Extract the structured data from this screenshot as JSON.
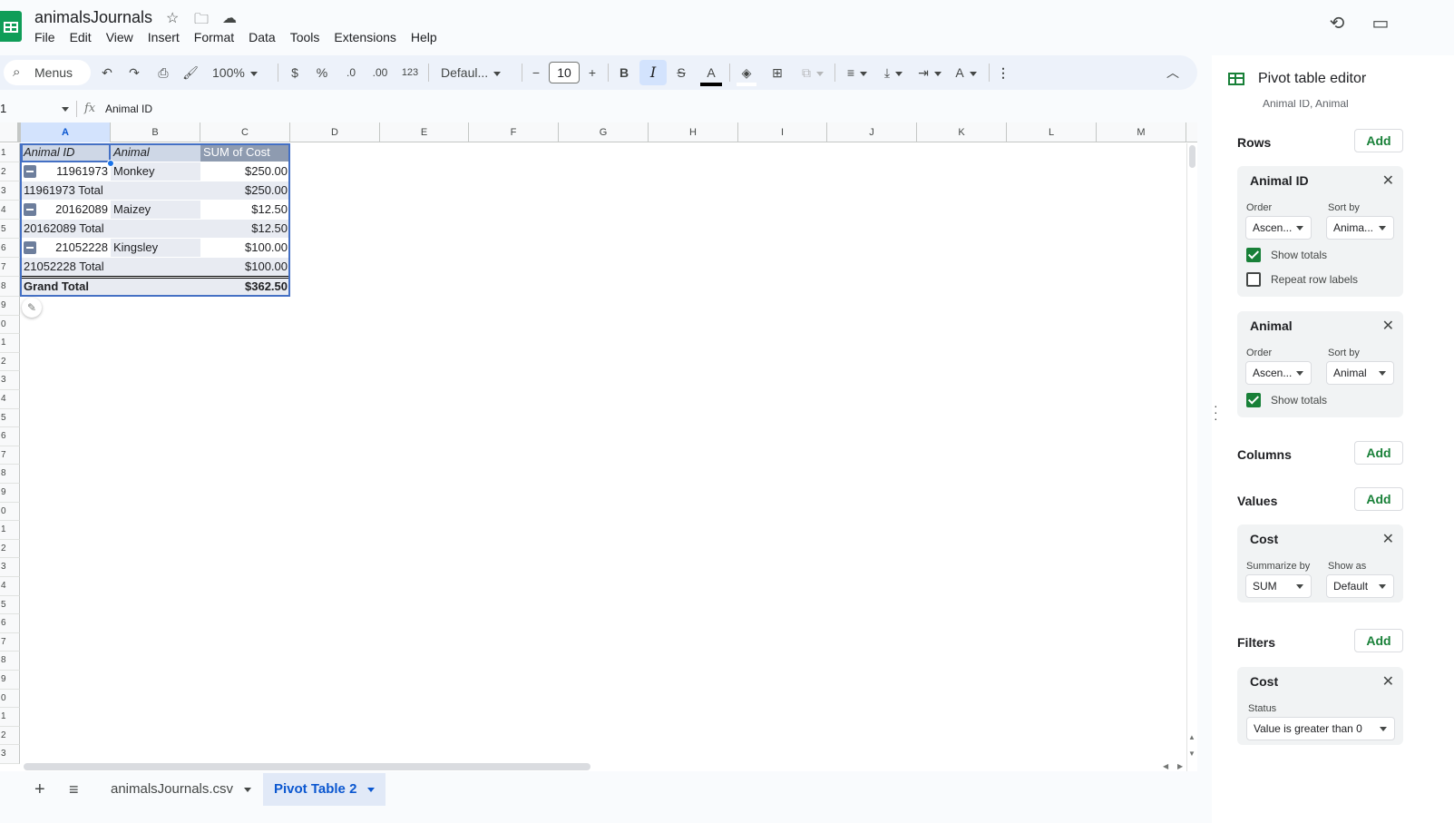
{
  "app": {
    "doc_title": "animalsJournals",
    "menu": [
      "File",
      "Edit",
      "View",
      "Insert",
      "Format",
      "Data",
      "Tools",
      "Extensions",
      "Help"
    ]
  },
  "toolbar": {
    "menus_label": "Menus",
    "zoom": "100%",
    "currency": "$",
    "percent": "%",
    "dec_decrease": ".0",
    "dec_increase": ".00",
    "format_123": "123",
    "font": "Defaul...",
    "font_size": "10",
    "bold": "B",
    "italic": "I"
  },
  "formula_bar": {
    "name_box": "1",
    "fx": "fx",
    "content": "Animal ID"
  },
  "columns": [
    "A",
    "B",
    "C",
    "D",
    "E",
    "F",
    "G",
    "H",
    "I",
    "J",
    "K",
    "L",
    "M"
  ],
  "rows": [
    "1",
    "2",
    "3",
    "4",
    "5",
    "6",
    "7",
    "8",
    "9",
    "0",
    "1",
    "2",
    "3",
    "4",
    "5",
    "6",
    "7",
    "8",
    "9",
    "0",
    "1",
    "2",
    "3",
    "4",
    "5",
    "6",
    "7",
    "8",
    "9",
    "0",
    "1",
    "2",
    "3"
  ],
  "pivot": {
    "header": [
      "Animal ID",
      "Animal",
      "SUM of Cost"
    ],
    "rows": [
      {
        "id": "11961973",
        "animal": "Monkey",
        "cost": "$250.00"
      },
      {
        "total_label": "11961973 Total",
        "cost": "$250.00"
      },
      {
        "id": "20162089",
        "animal": "Maizey",
        "cost": "$12.50"
      },
      {
        "total_label": "20162089 Total",
        "cost": "$12.50"
      },
      {
        "id": "21052228",
        "animal": "Kingsley",
        "cost": "$100.00"
      },
      {
        "total_label": "21052228 Total",
        "cost": "$100.00"
      }
    ],
    "grand_total_label": "Grand Total",
    "grand_total": "$362.50"
  },
  "sheet_tabs": {
    "add": "+",
    "list": "≡",
    "tabs": [
      "animalsJournals.csv",
      "Pivot Table 2"
    ],
    "active": 1
  },
  "panel": {
    "title": "Pivot table editor",
    "range_subtitle": "Animal ID, Animal",
    "add_label": "Add",
    "rows_label": "Rows",
    "columns_label": "Columns",
    "values_label": "Values",
    "filters_label": "Filters",
    "order_label": "Order",
    "sort_by_label": "Sort by",
    "show_totals": "Show totals",
    "repeat_row_labels": "Repeat row labels",
    "row_cards": [
      {
        "title": "Animal ID",
        "order": "Ascen...",
        "sort_by": "Anima..."
      },
      {
        "title": "Animal",
        "order": "Ascen...",
        "sort_by": "Animal"
      }
    ],
    "value_card": {
      "title": "Cost",
      "summarize_label": "Summarize by",
      "summarize": "SUM",
      "show_as_label": "Show as",
      "show_as": "Default"
    },
    "filter_card": {
      "title": "Cost",
      "status_label": "Status",
      "status": "Value is greater than 0"
    }
  }
}
